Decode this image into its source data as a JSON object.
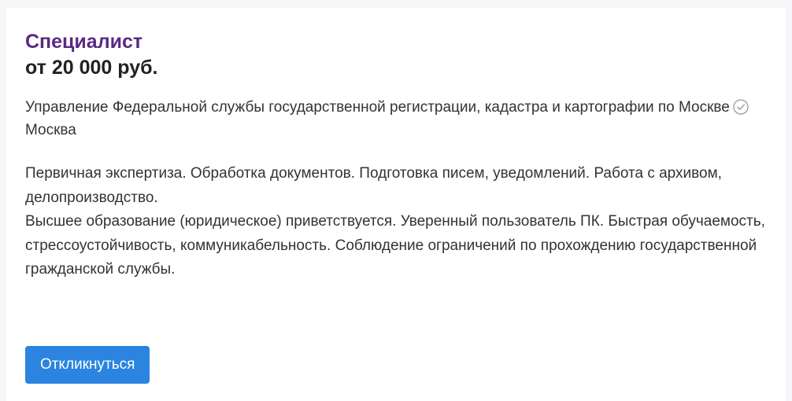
{
  "vacancy": {
    "title": "Специалист",
    "salary": "от 20 000 руб.",
    "employer": "Управление Федеральной службы государственной регистрации, кадастра и картографии по Москве",
    "verified_icon": "check-circle-icon",
    "city": "Москва",
    "description": [
      "Первичная экспертиза. Обработка документов. Подготовка писем, уведомлений. Работа с архивом, делопроизводство.",
      "Высшее образование (юридическое) приветствуется. Уверенный пользователь ПК. Быстрая обучаемость, стрессоустойчивость, коммуникабельность. Соблюдение ограничений по прохождению государственной гражданской службы."
    ],
    "apply_label": "Откликнуться"
  },
  "colors": {
    "title": "#5a2a82",
    "button": "#2a84e0",
    "text": "#333333"
  }
}
